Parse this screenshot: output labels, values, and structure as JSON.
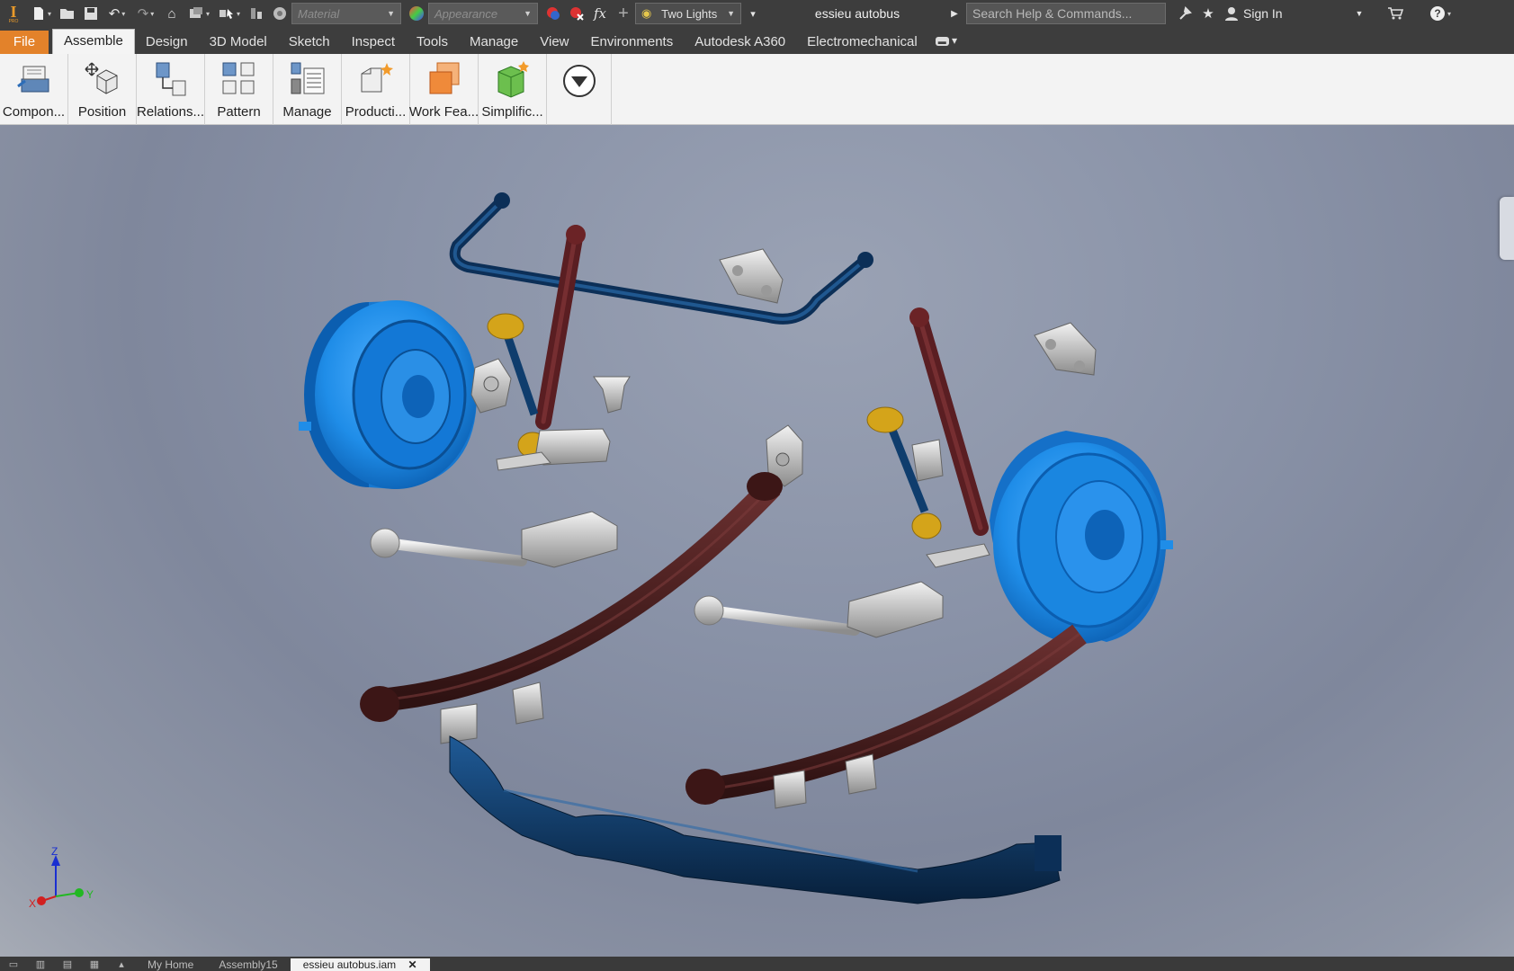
{
  "qat": {
    "material_placeholder": "Material",
    "appearance_placeholder": "Appearance",
    "lighting_label": "Two Lights",
    "document_title": "essieu autobus",
    "search_placeholder": "Search Help & Commands...",
    "sign_in_label": "Sign In",
    "icons": [
      "new-icon",
      "open-icon",
      "save-icon",
      "undo-icon",
      "redo-icon",
      "home-icon",
      "update-icon",
      "select-icon",
      "color-icon",
      "parameters-icon",
      "cart-icon",
      "help-icon"
    ]
  },
  "tabs": [
    {
      "label": "File"
    },
    {
      "label": "Assemble",
      "active": true
    },
    {
      "label": "Design"
    },
    {
      "label": "3D Model"
    },
    {
      "label": "Sketch"
    },
    {
      "label": "Inspect"
    },
    {
      "label": "Tools"
    },
    {
      "label": "Manage"
    },
    {
      "label": "View"
    },
    {
      "label": "Environments"
    },
    {
      "label": "Autodesk A360"
    },
    {
      "label": "Electromechanical"
    }
  ],
  "ribbon": [
    {
      "label": "Compon...",
      "icon": "component-icon"
    },
    {
      "label": "Position",
      "icon": "position-icon"
    },
    {
      "label": "Relations...",
      "icon": "relationships-icon"
    },
    {
      "label": "Pattern",
      "icon": "pattern-icon"
    },
    {
      "label": "Manage",
      "icon": "manage-icon"
    },
    {
      "label": "Producti...",
      "icon": "productivity-icon"
    },
    {
      "label": "Work Fea...",
      "icon": "work-features-icon"
    },
    {
      "label": "Simplific...",
      "icon": "simplification-icon"
    }
  ],
  "triad": {
    "x": "X",
    "y": "Y",
    "z": "Z"
  },
  "colors": {
    "file_tab": "#e3822a",
    "drum": "#1f8de8",
    "axle_beam": "#0d3a6a",
    "leaf_spring": "#4a1f1f",
    "shock": "#6b2326",
    "brass": "#d4a41a",
    "steel": "#c4c4c4"
  },
  "doc_tabs": [
    {
      "label": "My Home"
    },
    {
      "label": "Assembly15"
    },
    {
      "label": "essieu autobus.iam",
      "active": true
    }
  ]
}
